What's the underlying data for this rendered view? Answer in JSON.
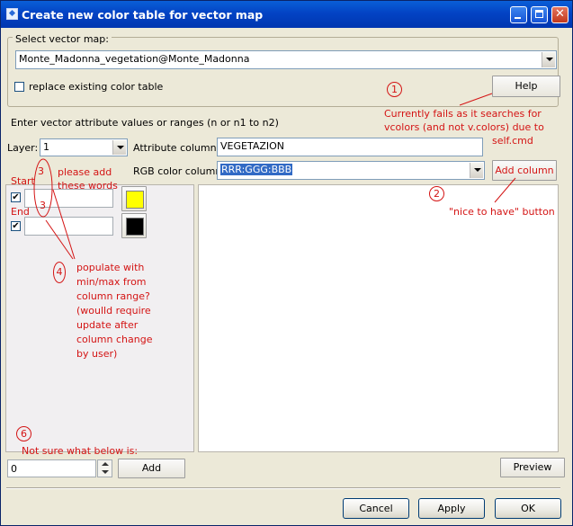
{
  "window": {
    "title": "Create new color table for vector map"
  },
  "vector_map": {
    "legend": "Select vector map:",
    "value": "Monte_Madonna_vegetation@Monte_Madonna",
    "replace_label": "replace existing color table",
    "help_label": "Help"
  },
  "instructions": "Enter vector attribute values or ranges (n or n1 to n2)",
  "layer": {
    "label": "Layer:",
    "value": "1"
  },
  "attribute_column": {
    "label": "Attribute column:",
    "value": "VEGETAZION"
  },
  "rgb_column": {
    "label": "RGB color column:",
    "value": "RRR:GGG:BBB",
    "add_column_label": "Add column"
  },
  "rules": [
    {
      "label": "Start",
      "checked": "✔",
      "color": "#ffff00"
    },
    {
      "label": "End",
      "checked": "✔",
      "color": "#000000"
    }
  ],
  "add_row": {
    "value": "0",
    "add_label": "Add"
  },
  "preview_label": "Preview",
  "buttons": {
    "cancel": "Cancel",
    "apply": "Apply",
    "ok": "OK"
  },
  "annotations": {
    "n1": "1",
    "n1_text": [
      "Currently fails as it searches for",
      "vcolors (and not v.colors) due to",
      "self.cmd"
    ],
    "n2": "2",
    "n2_text": "\"nice to have\" button",
    "n3a": "3",
    "n3b": "3",
    "n3_text": [
      "please add",
      "these words"
    ],
    "n4": "4",
    "n4_text": [
      "populate with",
      "min/max from",
      "column range?",
      "(woulld require",
      "update after",
      "column change",
      "by user)"
    ],
    "n6": "6",
    "n6_text": "Not sure what below is:"
  },
  "colors": {
    "title_bar": "#0343c4",
    "annotation": "#d41414"
  }
}
